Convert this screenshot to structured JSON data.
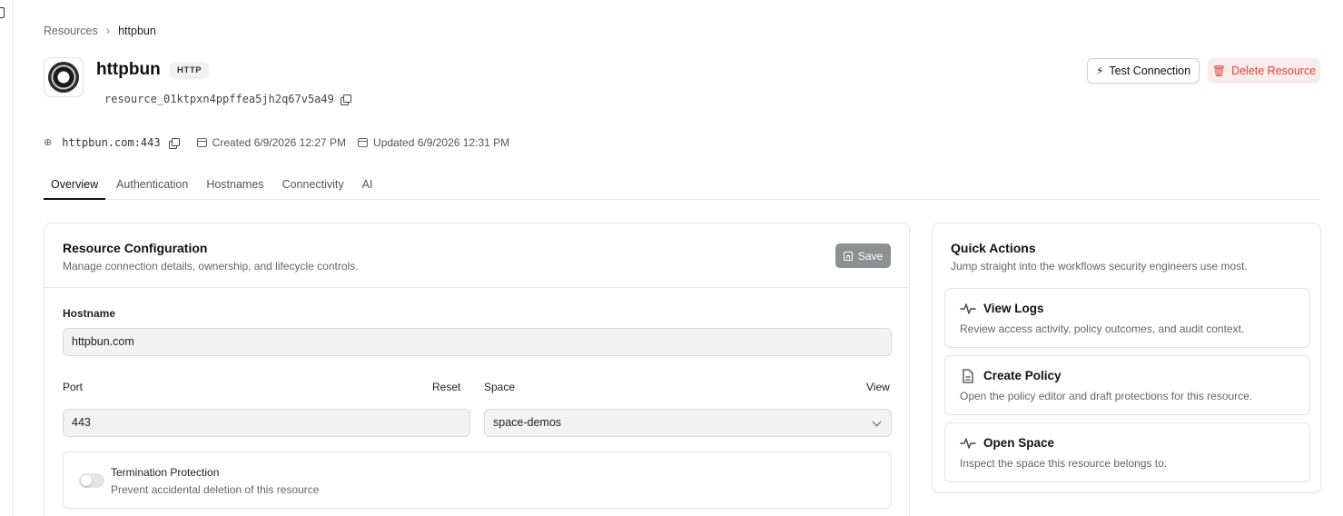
{
  "breadcrumb": {
    "root": "Resources",
    "current": "httpbun"
  },
  "resource": {
    "name": "httpbun",
    "type_badge": "HTTP",
    "id": "resource_01ktpxn4ppffea5jh2q67v5a49",
    "endpoint": "httpbun.com:443",
    "created": "Created 6/9/2026 12:27 PM",
    "updated": "Updated 6/9/2026 12:31 PM"
  },
  "actions": {
    "test_connection": "Test Connection",
    "delete_resource": "Delete Resource"
  },
  "tabs": [
    {
      "label": "Overview",
      "active": true
    },
    {
      "label": "Authentication",
      "active": false
    },
    {
      "label": "Hostnames",
      "active": false
    },
    {
      "label": "Connectivity",
      "active": false
    },
    {
      "label": "AI",
      "active": false
    }
  ],
  "config": {
    "title": "Resource Configuration",
    "subtitle": "Manage connection details, ownership, and lifecycle controls.",
    "save_label": "Save",
    "hostname_label": "Hostname",
    "hostname_value": "httpbun.com",
    "port_label": "Port",
    "port_reset": "Reset",
    "port_value": "443",
    "space_label": "Space",
    "space_view": "View",
    "space_value": "space-demos",
    "termination": {
      "title": "Termination Protection",
      "description": "Prevent accidental deletion of this resource",
      "enabled": false
    }
  },
  "quick_actions": {
    "title": "Quick Actions",
    "subtitle": "Jump straight into the workflows security engineers use most.",
    "items": [
      {
        "title": "View Logs",
        "description": "Review access activity, policy outcomes, and audit context.",
        "icon": "activity-icon"
      },
      {
        "title": "Create Policy",
        "description": "Open the policy editor and draft protections for this resource.",
        "icon": "document-icon"
      },
      {
        "title": "Open Space",
        "description": "Inspect the space this resource belongs to.",
        "icon": "activity-icon"
      }
    ]
  },
  "colors": {
    "danger": "#d64545",
    "danger_bg": "#fbecec",
    "save_bg": "#8d8f93"
  }
}
